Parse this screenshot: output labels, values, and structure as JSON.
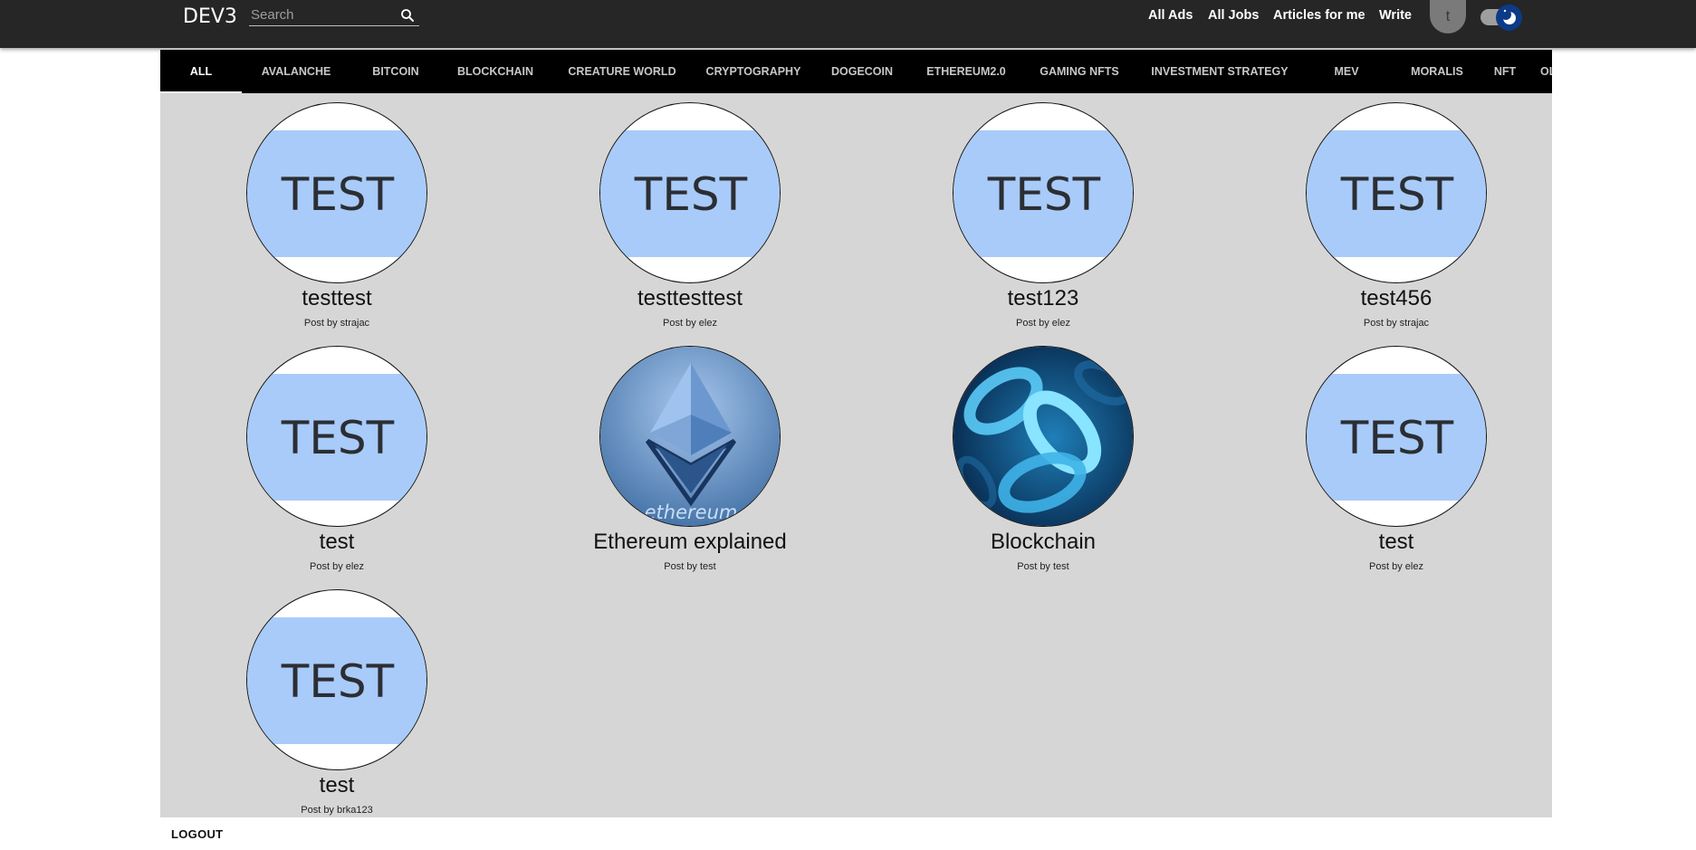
{
  "header": {
    "brand": "DEV3",
    "search_placeholder": "Search",
    "nav": [
      "All Ads",
      "All Jobs",
      "Articles for me",
      "Write"
    ],
    "avatar_letter": "t"
  },
  "tabs": [
    "ALL",
    "AVALANCHE",
    "BITCOIN",
    "BLOCKCHAIN",
    "CREATURE WORLD",
    "CRYPTOGRAPHY",
    "DOGECOIN",
    "ETHEREUM2.0",
    "GAMING NFTS",
    "INVESTMENT STRATEGY",
    "MEV",
    "MORALIS",
    "NFT",
    "OLYMPUS DAO"
  ],
  "posts": [
    {
      "title": "testtest",
      "by": "Post by strajac",
      "image": "test-image"
    },
    {
      "title": "testtesttest",
      "by": "Post by elez",
      "image": "test-image"
    },
    {
      "title": "test123",
      "by": "Post by elez",
      "image": "test-image"
    },
    {
      "title": "test456",
      "by": "Post by strajac",
      "image": "test-image"
    },
    {
      "title": "test",
      "by": "Post by elez",
      "image": "test-image"
    },
    {
      "title": "Ethereum explained",
      "by": "Post by test",
      "image": "ethereum-image",
      "image_text": "ethereum"
    },
    {
      "title": "Blockchain",
      "by": "Post by test",
      "image": "blockchain-image"
    },
    {
      "title": "test",
      "by": "Post by elez",
      "image": "test-image"
    },
    {
      "title": "test",
      "by": "Post by brka123",
      "image": "test-image"
    }
  ],
  "test_image_text": "TEST",
  "footer": {
    "logout": "LOGOUT"
  }
}
